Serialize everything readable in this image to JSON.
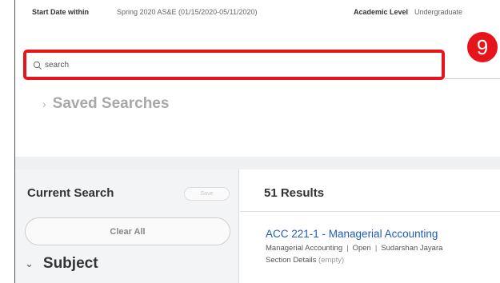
{
  "filters": {
    "start_date_label": "Start Date within",
    "start_date_value": "Spring 2020 AS&E (01/15/2020-05/11/2020)",
    "academic_level_label": "Academic Level",
    "academic_level_value": "Undergraduate"
  },
  "search": {
    "placeholder": "search",
    "icon": "search-icon"
  },
  "annotation": {
    "step_number": "9",
    "color": "#e8141c"
  },
  "saved_searches": {
    "label": "Saved Searches",
    "icon": "chevron-right-icon"
  },
  "current_search": {
    "title": "Current Search",
    "save_label": "Save",
    "clear_all_label": "Clear All",
    "subject_label": "Subject",
    "subject_icon": "chevron-down-icon"
  },
  "results": {
    "count_label": "51 Results",
    "items": [
      {
        "title": "ACC 221-1 - Managerial Accounting",
        "course_name": "Managerial Accounting",
        "status": "Open",
        "instructor": "Sudarshan Jayara",
        "details_label": "Section Details",
        "details_value": "(empty)"
      }
    ]
  },
  "colors": {
    "link": "#1e5bb8",
    "highlight": "#e8141c",
    "panel_bg": "#f3f4f6"
  }
}
